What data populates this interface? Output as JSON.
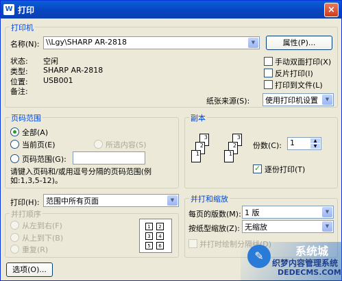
{
  "window": {
    "title": "打印",
    "close": "×"
  },
  "printer": {
    "group_label": "打印机",
    "name_label": "名称(N):",
    "name_value": "\\\\Lgy\\SHARP AR-2818",
    "properties_button": "属性(P)...",
    "status_label": "状态:",
    "status_value": "空闲",
    "type_label": "类型:",
    "type_value": "SHARP AR-2818",
    "location_label": "位置:",
    "location_value": "USB001",
    "comment_label": "备注:",
    "manual_duplex": "手动双面打印(X)",
    "reverse_print": "反片打印(I)",
    "print_to_file": "打印到文件(L)",
    "paper_source_label": "纸张来源(S):",
    "paper_source_value": "使用打印机设置"
  },
  "page_range": {
    "group_label": "页码范围",
    "all": "全部(A)",
    "current_page": "当前页(E)",
    "selection": "所选内容(S)",
    "pages": "页码范围(G):",
    "pages_value": "",
    "hint": "请键入页码和/或用逗号分隔的页码范围(例如:1,3,5-12)。"
  },
  "copies": {
    "group_label": "副本",
    "count_label": "份数(C):",
    "count_value": "1",
    "collate": "逐份打印(T)"
  },
  "print_what": {
    "label": "打印(H):",
    "value": "范围中所有页面"
  },
  "page_order": {
    "group_label": "并打顺序",
    "left_to_right": "从左到右(F)",
    "top_to_bottom": "从上到下(B)",
    "repeat": "重复(R)"
  },
  "zoom": {
    "group_label": "并打和缩放",
    "pages_per_sheet_label": "每页的版数(M):",
    "pages_per_sheet_value": "1 版",
    "scale_label": "按纸型缩放(Z):",
    "scale_value": "无缩放",
    "draw_borders": "并打时绘制分隔线(D)"
  },
  "options_button": "选项(O)...",
  "watermark": {
    "brand": "系统城",
    "line1": "织梦内容管理系统",
    "line2": "DEDECMS.COM"
  }
}
